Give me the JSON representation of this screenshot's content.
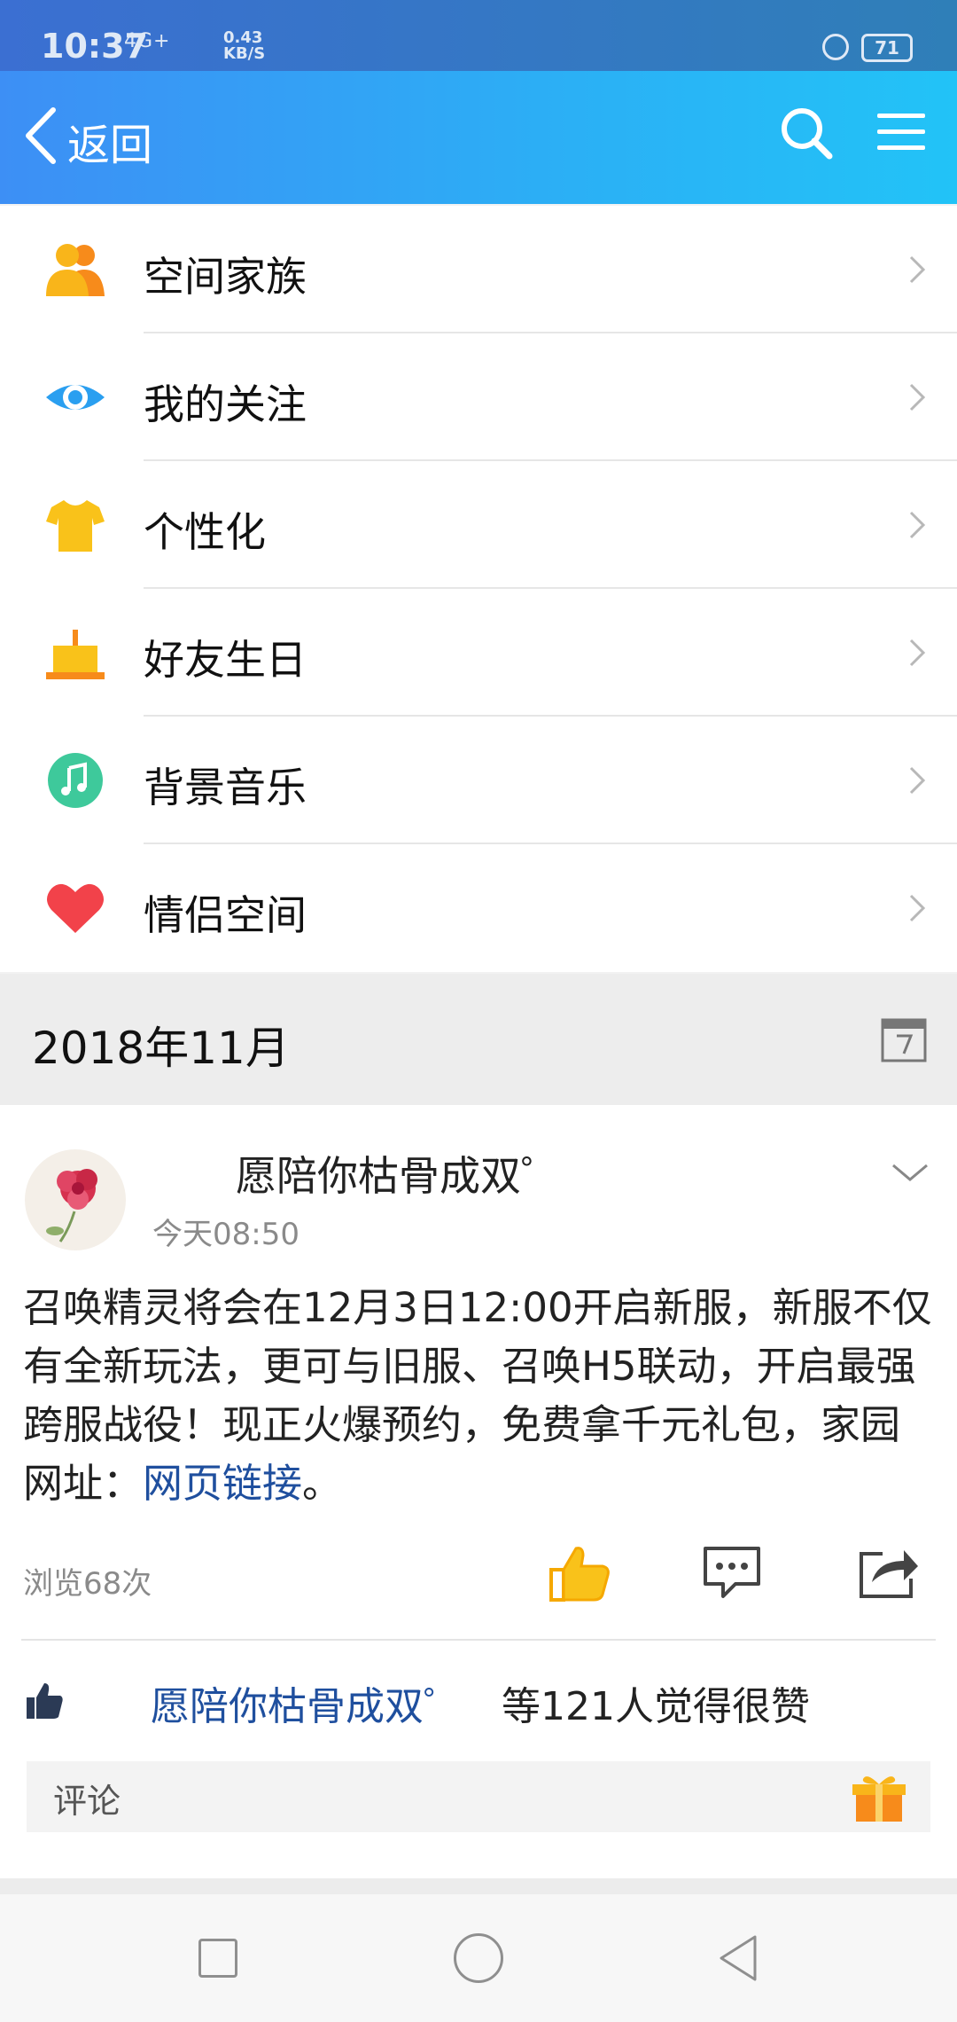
{
  "status_bar": {
    "time": "10:37",
    "signal": "4G+",
    "speed_value": "0.43",
    "speed_unit": "KB/S",
    "battery": "71"
  },
  "header": {
    "back_label": "返回",
    "search_icon": "search-icon",
    "menu_icon": "menu-icon",
    "gradient_start": "#3d8ff5",
    "gradient_end": "#22c3f7"
  },
  "menu": {
    "items": [
      {
        "label": "空间家族",
        "icon": "family-icon",
        "color": "#f7a81b"
      },
      {
        "label": "我的关注",
        "icon": "eye-icon",
        "color": "#2a9ff0"
      },
      {
        "label": "个性化",
        "icon": "tshirt-icon",
        "color": "#f9c21a"
      },
      {
        "label": "好友生日",
        "icon": "cake-icon",
        "color": "#f7a81b"
      },
      {
        "label": "背景音乐",
        "icon": "music-icon",
        "color": "#3ec99b"
      },
      {
        "label": "情侣空间",
        "icon": "heart-icon",
        "color": "#f2424a"
      }
    ]
  },
  "timeline": {
    "month": "2018年11月"
  },
  "post": {
    "author": "愿陪你枯骨成双゜",
    "time": "今天08:50",
    "body": "召唤精灵将会在12月3日12:00开启新服，新服不仅有全新玩法，更可与旧服、召唤H5联动，开启最强跨服战役！现正火爆预约，免费拿千元礼包，家园网址：",
    "link_text": "网页链接",
    "body_end": "。",
    "views": "浏览68次",
    "liked_by": "愿陪你枯骨成双゜",
    "liked_suffix": "等121人觉得很赞",
    "comment_placeholder": "评论",
    "link_color": "#1f4f9e"
  }
}
